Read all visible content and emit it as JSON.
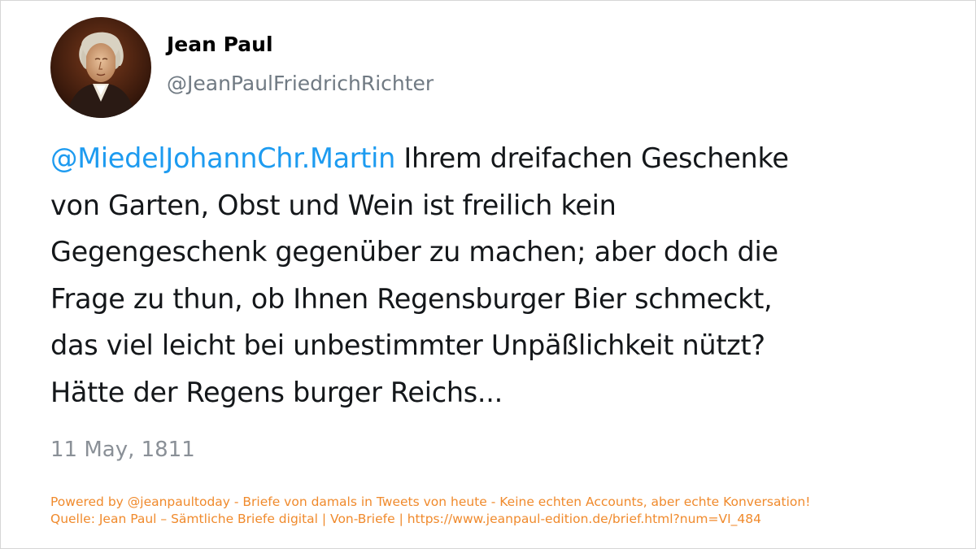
{
  "tweet": {
    "author_name": "Jean Paul",
    "author_handle": "@JeanPaulFriedrichRichter",
    "avatar_icon": "portrait-avatar",
    "mention": "@MiedelJohannChr.Martin",
    "text_lines": [
      " Ihrem dreifachen Geschenke",
      "von Garten, Obst und Wein ist freilich kein",
      "Gegengeschenk gegenüber zu machen; aber doch die",
      "Frage zu thun, ob Ihnen Regensburger Bier schmeckt,",
      "das viel leicht bei unbestimmter Unpäßlichkeit nützt?",
      "Hätte der Regens burger Reichs..."
    ],
    "date": "11 May, 1811"
  },
  "footer": {
    "line1": "Powered by @jeanpaultoday - Briefe von damals in Tweets von heute - Keine echten Accounts, aber echte Konversation!",
    "line2": "Quelle: Jean Paul – Sämtliche Briefe digital | Von-Briefe | https://www.jeanpaul-edition.de/brief.html?num=VI_484"
  },
  "colors": {
    "mention": "#1d9bf0",
    "text": "#14171a",
    "muted": "#707a83",
    "footer": "#f08a2c"
  }
}
